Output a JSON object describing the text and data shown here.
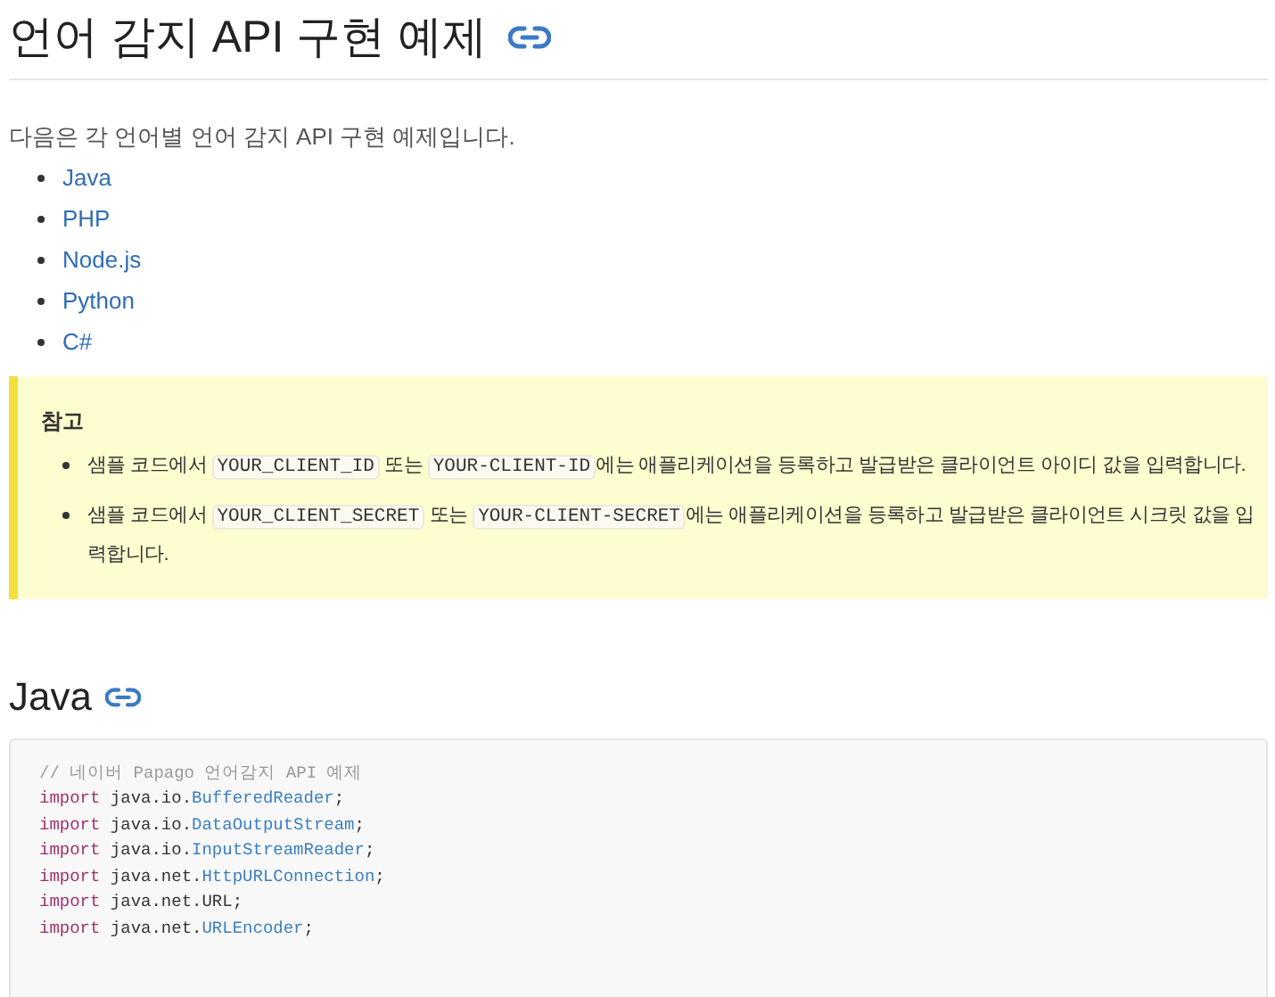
{
  "title": "언어 감지 API 구현 예제",
  "intro": "다음은 각 언어별 언어 감지 API 구현 예제입니다.",
  "links": [
    "Java",
    "PHP",
    "Node.js",
    "Python",
    "C#"
  ],
  "note": {
    "title": "참고",
    "items": [
      [
        {
          "kind": "text",
          "text": "샘플 코드에서 "
        },
        {
          "kind": "code",
          "text": "YOUR_CLIENT_ID"
        },
        {
          "kind": "text",
          "text": " 또는 "
        },
        {
          "kind": "code",
          "text": "YOUR-CLIENT-ID"
        },
        {
          "kind": "text",
          "text": "에는 애플리케이션을 등록하고 발급받은 클라이언트 아이디 값을 입력합니다."
        }
      ],
      [
        {
          "kind": "text",
          "text": "샘플 코드에서 "
        },
        {
          "kind": "code",
          "text": "YOUR_CLIENT_SECRET"
        },
        {
          "kind": "text",
          "text": " 또는 "
        },
        {
          "kind": "code",
          "text": "YOUR-CLIENT-SECRET"
        },
        {
          "kind": "text",
          "text": "에는 애플리케이션을 등록하고 발급받은 클라이언트 시크릿 값을 입력합니다."
        }
      ]
    ]
  },
  "section_title": "Java",
  "code": [
    [
      {
        "kind": "comment",
        "text": "// 네이버 Papago 언어감지 API 예제"
      }
    ],
    [
      {
        "kind": "keyword",
        "text": "import"
      },
      {
        "kind": "plain",
        "text": " java.io."
      },
      {
        "kind": "type",
        "text": "BufferedReader"
      },
      {
        "kind": "plain",
        "text": ";"
      }
    ],
    [
      {
        "kind": "keyword",
        "text": "import"
      },
      {
        "kind": "plain",
        "text": " java.io."
      },
      {
        "kind": "type",
        "text": "DataOutputStream"
      },
      {
        "kind": "plain",
        "text": ";"
      }
    ],
    [
      {
        "kind": "keyword",
        "text": "import"
      },
      {
        "kind": "plain",
        "text": " java.io."
      },
      {
        "kind": "type",
        "text": "InputStreamReader"
      },
      {
        "kind": "plain",
        "text": ";"
      }
    ],
    [
      {
        "kind": "keyword",
        "text": "import"
      },
      {
        "kind": "plain",
        "text": " java.net."
      },
      {
        "kind": "type",
        "text": "HttpURLConnection"
      },
      {
        "kind": "plain",
        "text": ";"
      }
    ],
    [
      {
        "kind": "keyword",
        "text": "import"
      },
      {
        "kind": "plain",
        "text": " java.net.URL;"
      }
    ],
    [
      {
        "kind": "keyword",
        "text": "import"
      },
      {
        "kind": "plain",
        "text": " java.net."
      },
      {
        "kind": "type",
        "text": "URLEncoder"
      },
      {
        "kind": "plain",
        "text": ";"
      }
    ]
  ]
}
